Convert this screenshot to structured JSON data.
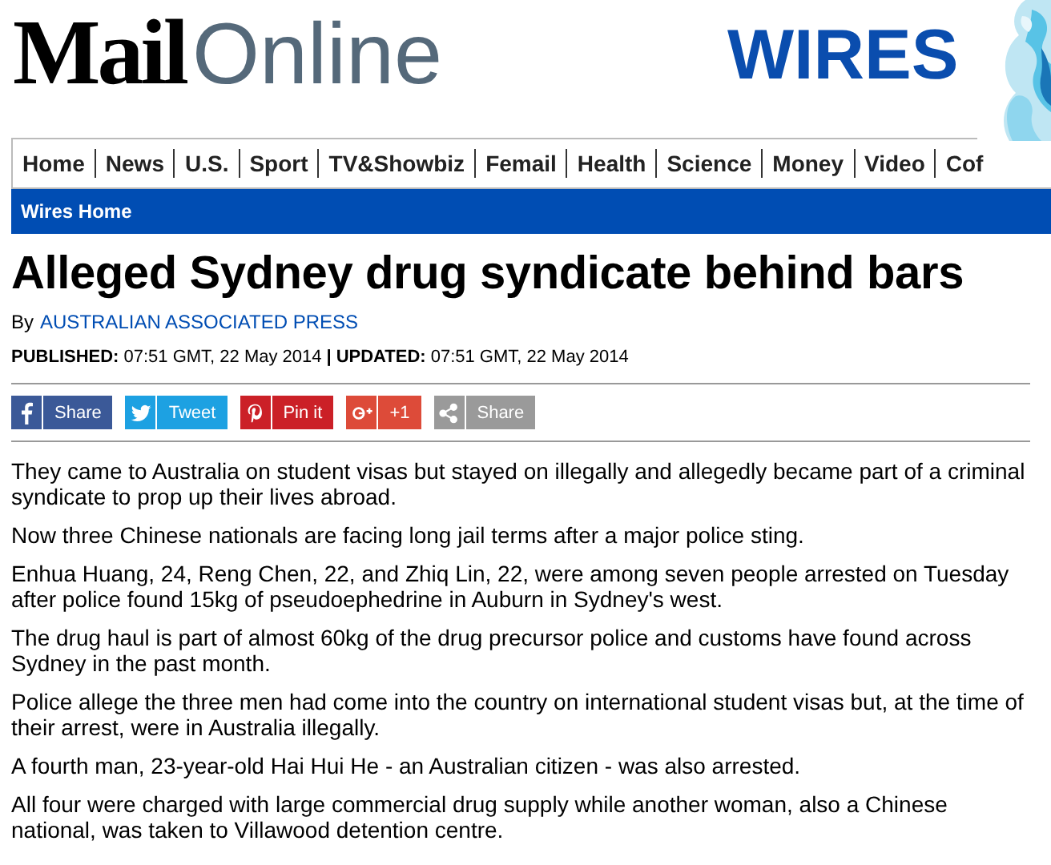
{
  "masthead": {
    "logo_bold": "Mail",
    "logo_light": "Online",
    "section_logo": "WIRES"
  },
  "nav": {
    "items": [
      {
        "label": "Home"
      },
      {
        "label": "News"
      },
      {
        "label": "U.S."
      },
      {
        "label": "Sport"
      },
      {
        "label": "TV&Showbiz"
      },
      {
        "label": "Femail"
      },
      {
        "label": "Health"
      },
      {
        "label": "Science"
      },
      {
        "label": "Money"
      },
      {
        "label": "Video"
      },
      {
        "label": "Cof"
      }
    ]
  },
  "subnav": {
    "items": [
      {
        "label": "Wires Home"
      }
    ]
  },
  "article": {
    "headline": "Alleged Sydney drug syndicate behind bars",
    "byline_prefix": "By",
    "byline_author": "AUSTRALIAN ASSOCIATED PRESS",
    "published_label": "PUBLISHED:",
    "published": "07:51 GMT, 22 May 2014",
    "separator": "|",
    "updated_label": "UPDATED:",
    "updated": "07:51 GMT, 22 May 2014",
    "share_buttons": [
      {
        "kind": "facebook",
        "label": "Share",
        "color": "#3b5998"
      },
      {
        "kind": "twitter",
        "label": "Tweet",
        "color": "#1da1e2"
      },
      {
        "kind": "pinterest",
        "label": "Pin it",
        "color": "#cb2027"
      },
      {
        "kind": "googleplus",
        "label": "+1",
        "color": "#dd4b39"
      },
      {
        "kind": "share",
        "label": "Share",
        "color": "#9a9a9a"
      }
    ],
    "paragraphs": [
      "They came to Australia on student visas but stayed on illegally and allegedly became part of a criminal syndicate to prop up their lives abroad.",
      "Now three Chinese nationals are facing long jail terms after a major police sting.",
      "Enhua Huang, 24, Reng Chen, 22, and Zhiq Lin, 22, were among seven people arrested on Tuesday after police found 15kg of pseudoephedrine in Auburn in Sydney's west.",
      "The drug haul is part of almost 60kg of the drug precursor police and customs have found across Sydney in the past month.",
      "Police allege the three men had come into the country on international student visas but, at the time of their arrest, were in Australia illegally.",
      "A fourth man, 23-year-old Hai Hui He - an Australian citizen - was also arrested.",
      "All four were charged with large commercial drug supply while another woman, also a Chinese national, was taken to Villawood detention centre."
    ]
  }
}
